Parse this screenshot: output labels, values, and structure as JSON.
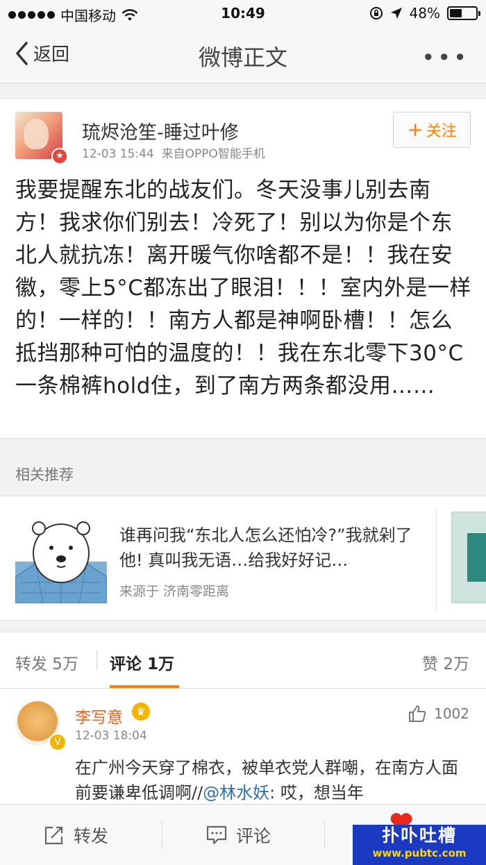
{
  "status_bar": {
    "carrier": "中国移动",
    "time": "10:49",
    "battery": "48%",
    "battery_level": 0.48
  },
  "nav": {
    "back_label": "返回",
    "title": "微博正文",
    "more_label": "•••"
  },
  "post": {
    "author": "琉烬沧笙-睡过叶修",
    "time": "12-03 15:44",
    "source": "来自OPPO智能手机",
    "follow_label": "关注",
    "text": "我要提醒东北的战友们。冬天没事儿别去南方！我求你们别去！冷死了！别以为你是个东北人就抗冻！离开暖气你啥都不是！！我在安徽，零上5°C都冻出了眼泪！！！室内外是一样的！一样的！！南方人都是神啊卧槽！！怎么抵挡那种可怕的温度的！！我在东北零下30°C一条棉裤hold住，到了南方两条都没用……"
  },
  "related": {
    "heading": "相关推荐",
    "title": "谁再问我“东北人怎么还怕冷?”我就剁了他! 真叫我无语…给我好好记…",
    "source": "来源于  济南零距离"
  },
  "stats": {
    "forward": "转发 5万",
    "comment_label": "评论",
    "comment_count": "1万",
    "like": "赞 2万"
  },
  "comment": {
    "name": "李写意",
    "time": "12-03 18:04",
    "likes": "1002",
    "text_before": "在广州今天穿了棉衣，被单衣党人群嘲，在南方人面前要谦卑低调啊//",
    "mention": "@林水妖",
    "text_after": ": 哎，想当年"
  },
  "toolbar": {
    "forward_label": "转发",
    "comment_label": "评论"
  },
  "watermark": {
    "main": "扑卟吐槽",
    "url": "www.pubtc.com"
  },
  "colors": {
    "accent": "#ff8200",
    "link": "#2f6fab",
    "name_orange": "#e8621c"
  }
}
